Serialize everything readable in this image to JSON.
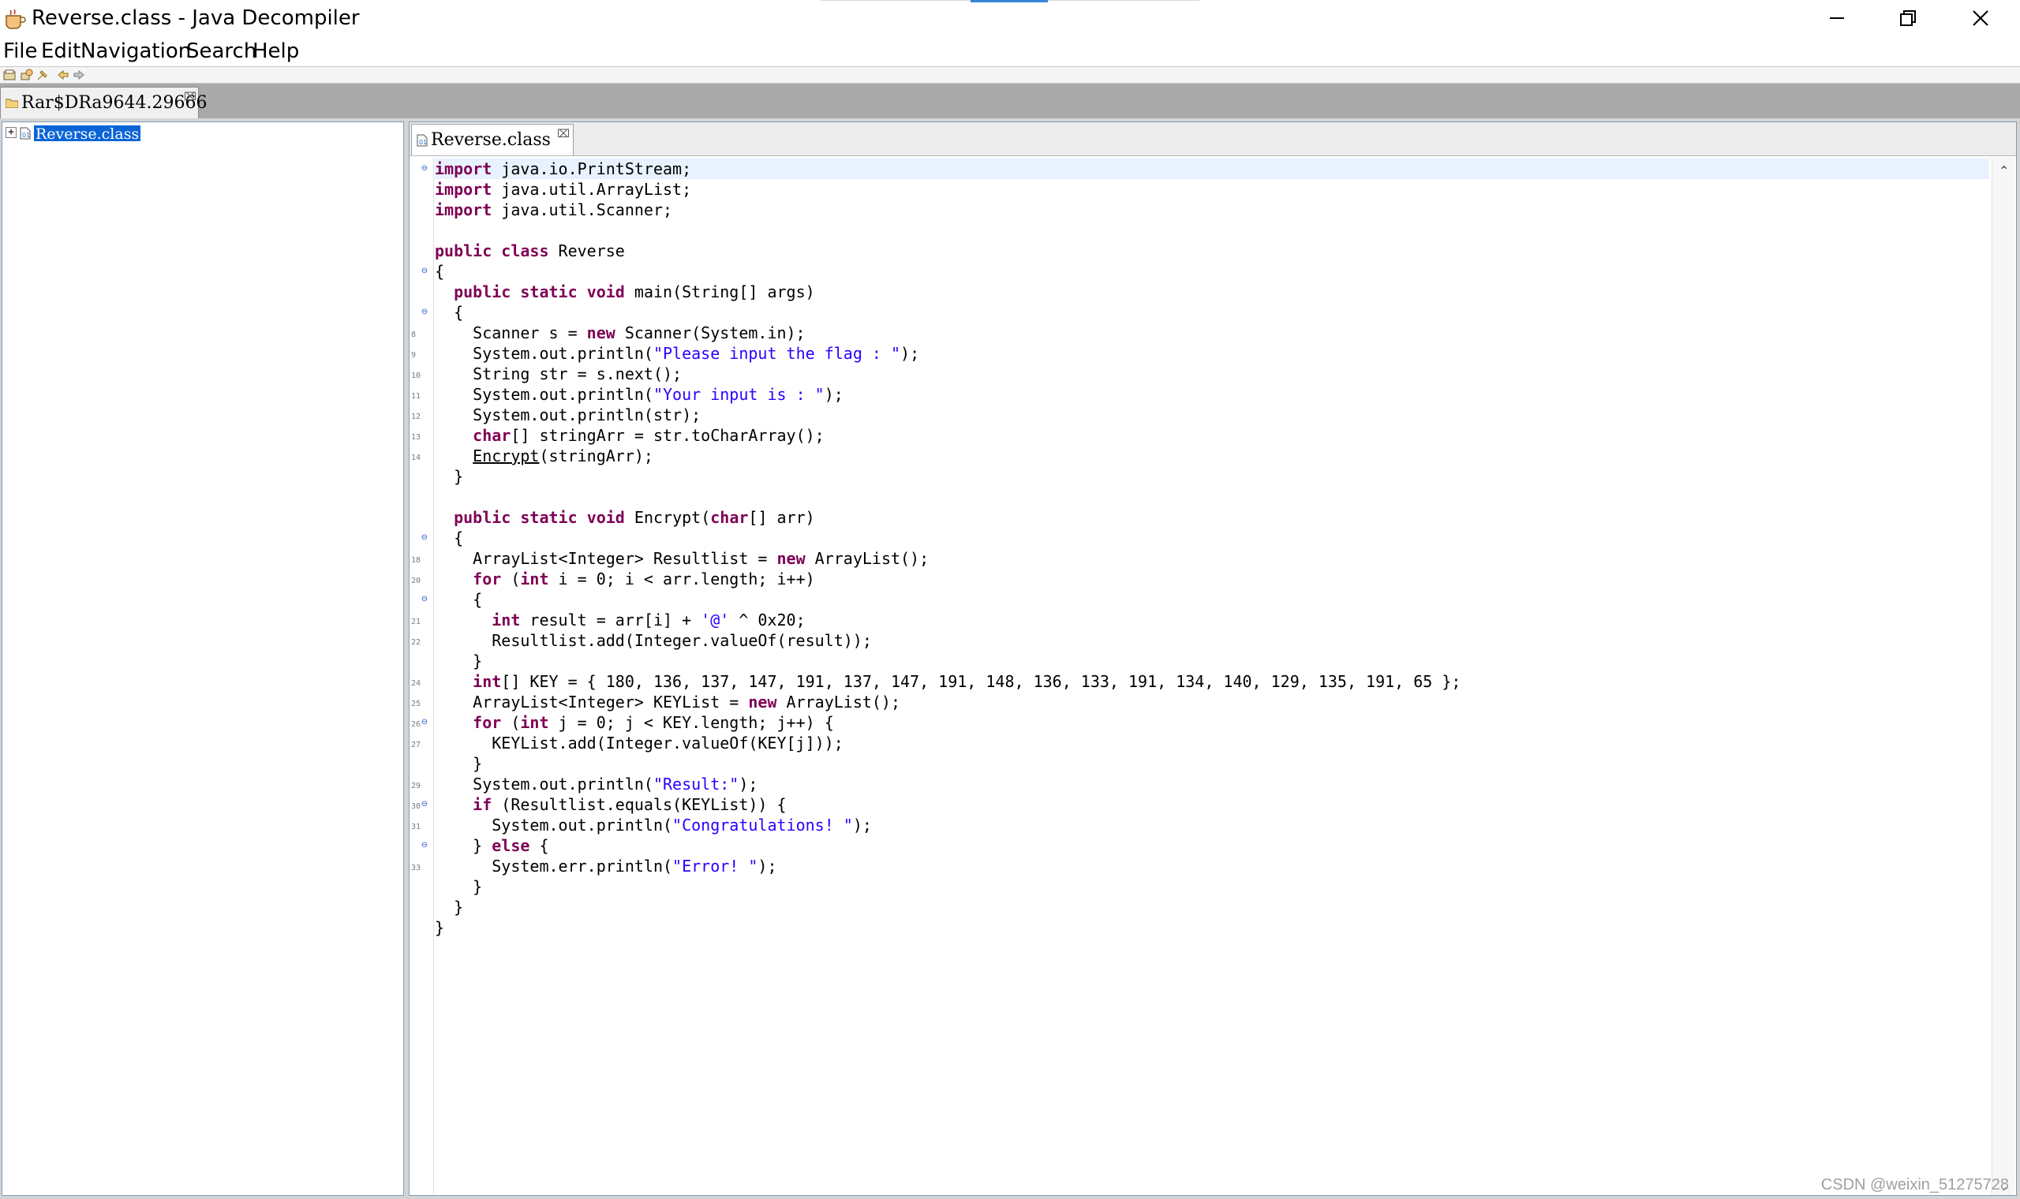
{
  "window": {
    "title": "Reverse.class - Java Decompiler",
    "controls": {
      "minimize": "minimize",
      "restore": "restore",
      "close": "close"
    }
  },
  "menu": {
    "items": [
      "File",
      "Edit",
      "Navigation",
      "Search",
      "Help"
    ]
  },
  "toolbar": {
    "icons": [
      "open-file-icon",
      "open-type-icon",
      "pin-icon",
      "back-icon",
      "forward-icon"
    ]
  },
  "archive_tab": {
    "label": "Rar$DRa9644.29666",
    "close": "⌧"
  },
  "tree": {
    "items": [
      {
        "label": "Reverse.class",
        "expander": "+",
        "selected": true
      }
    ]
  },
  "editor": {
    "tab": {
      "label": "Reverse.class",
      "close": "⌧"
    },
    "code": [
      "import java.io.PrintStream;",
      "import java.util.ArrayList;",
      "import java.util.Scanner;",
      "",
      "public class Reverse",
      "{",
      "  public static void main(String[] args)",
      "  {",
      "    Scanner s = new Scanner(System.in);",
      "    System.out.println(\"Please input the flag : \");",
      "    String str = s.next();",
      "    System.out.println(\"Your input is : \");",
      "    System.out.println(str);",
      "    char[] stringArr = str.toCharArray();",
      "    Encrypt(stringArr);",
      "  }",
      "",
      "  public static void Encrypt(char[] arr)",
      "  {",
      "    ArrayList<Integer> Resultlist = new ArrayList();",
      "    for (int i = 0; i < arr.length; i++)",
      "    {",
      "      int result = arr[i] + '@' ^ 0x20;",
      "      Resultlist.add(Integer.valueOf(result));",
      "    }",
      "    int[] KEY = { 180, 136, 137, 147, 191, 137, 147, 191, 148, 136, 133, 191, 134, 140, 129, 135, 191, 65 };",
      "    ArrayList<Integer> KEYList = new ArrayList();",
      "    for (int j = 0; j < KEY.length; j++) {",
      "      KEYList.add(Integer.valueOf(KEY[j]));",
      "    }",
      "    System.out.println(\"Result:\");",
      "    if (Resultlist.equals(KEYList)) {",
      "      System.out.println(\"Congratulations! \");",
      "    } else {",
      "      System.err.println(\"Error! \");",
      "    }",
      "  }",
      "}"
    ],
    "line_numbers": [
      "",
      "",
      "",
      "",
      "",
      "",
      "",
      "",
      "8",
      "9",
      "10",
      "11",
      "12",
      "13",
      "14",
      "",
      "",
      "",
      "",
      "18",
      "20",
      "",
      "21",
      "22",
      "",
      "24",
      "25",
      "26",
      "27",
      "",
      "29",
      "30",
      "31",
      "",
      "33",
      "",
      "",
      ""
    ],
    "fold_markers": [
      "⊖",
      "",
      "",
      "",
      "",
      "⊖",
      "",
      "⊖",
      "",
      "",
      "",
      "",
      "",
      "",
      "",
      "",
      "",
      "",
      "⊖",
      "",
      "",
      "⊖",
      "",
      "",
      "",
      "",
      "",
      "⊖",
      "",
      "",
      "",
      "⊖",
      "",
      "⊖",
      "",
      "",
      "",
      ""
    ],
    "keywords": [
      "import",
      "public",
      "class",
      "static",
      "void",
      "new",
      "char",
      "for",
      "int",
      "if",
      "else"
    ]
  },
  "watermark": "CSDN @weixin_51275728"
}
